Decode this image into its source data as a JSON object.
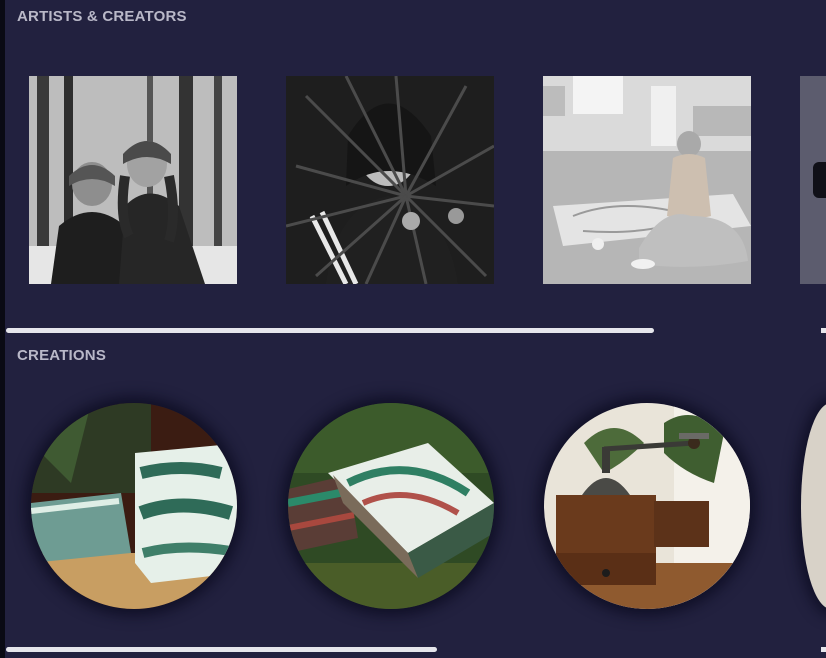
{
  "sections": {
    "artists": {
      "title": "ARTISTS & CREATORS"
    },
    "creations": {
      "title": "CREATIONS"
    }
  },
  "artists_scroll": {
    "visible_fraction": 0.79
  },
  "creations_scroll": {
    "visible_fraction": 0.52
  },
  "colors": {
    "background": "#22213f",
    "heading": "#b9b8c8",
    "scrollbar": "#e6e6ec"
  },
  "icons": {
    "carousel_next": "chevron-right-icon"
  }
}
